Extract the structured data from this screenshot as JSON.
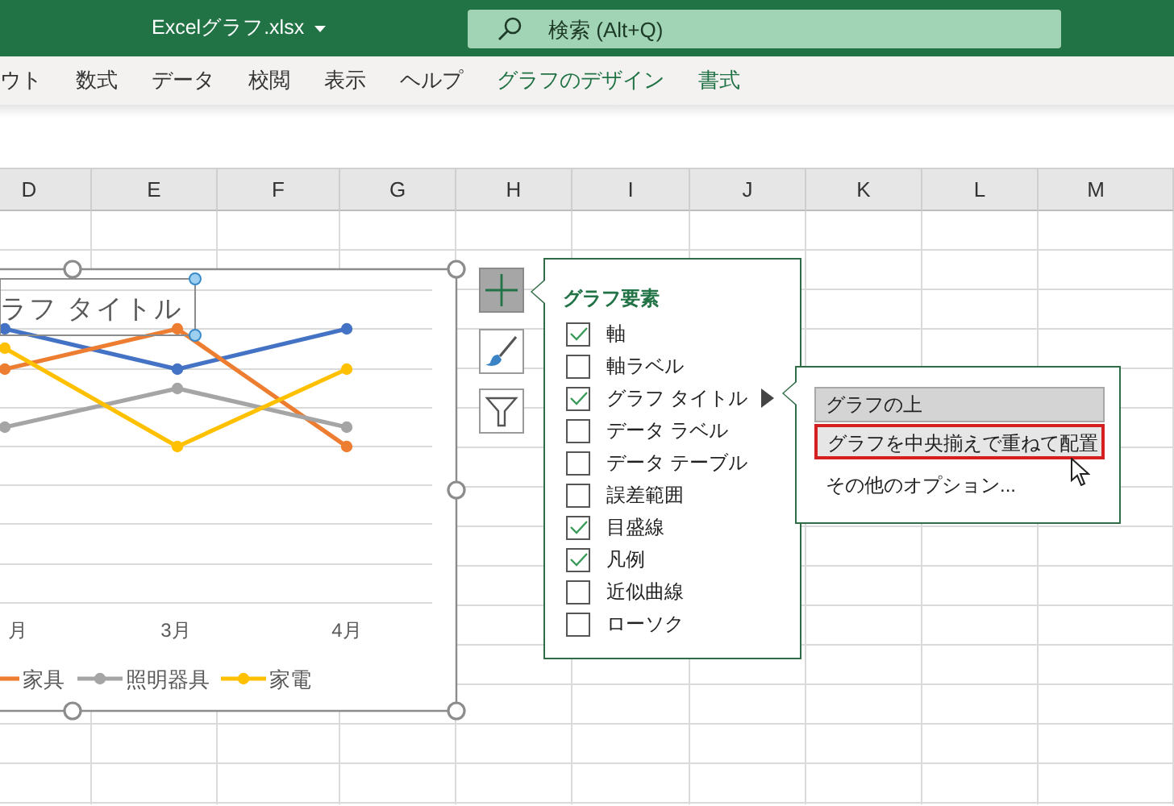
{
  "title_bar": {
    "filename": "Excelグラフ.xlsx",
    "search": {
      "placeholder": "検索 (Alt+Q)"
    }
  },
  "ribbon_tabs": [
    {
      "label": "ウト",
      "contextual": false
    },
    {
      "label": "数式",
      "contextual": false
    },
    {
      "label": "データ",
      "contextual": false
    },
    {
      "label": "校閲",
      "contextual": false
    },
    {
      "label": "表示",
      "contextual": false
    },
    {
      "label": "ヘルプ",
      "contextual": false
    },
    {
      "label": "グラフのデザイン",
      "contextual": true
    },
    {
      "label": "書式",
      "contextual": true
    }
  ],
  "column_headers": [
    "D",
    "E",
    "F",
    "G",
    "H",
    "I",
    "J",
    "K",
    "L",
    "M"
  ],
  "chart": {
    "title": "ラフ タイトル",
    "x_labels": [
      "月",
      "3月",
      "4月"
    ],
    "series": [
      {
        "color": "#4472c4"
      },
      {
        "color": "#ed7d31",
        "legend": "家具"
      },
      {
        "color": "#a5a5a5",
        "legend": "照明器具"
      },
      {
        "color": "#ffc000",
        "legend": "家電"
      }
    ]
  },
  "chart_buttons": [
    {
      "kind": "elements",
      "selected": true
    },
    {
      "kind": "styles",
      "selected": false
    },
    {
      "kind": "filter",
      "selected": false
    }
  ],
  "elements_panel": {
    "title": "グラフ要素",
    "items": [
      {
        "label": "軸",
        "checked": true,
        "expanded": false
      },
      {
        "label": "軸ラベル",
        "checked": false,
        "expanded": false
      },
      {
        "label": "グラフ タイトル",
        "checked": true,
        "expanded": true
      },
      {
        "label": "データ ラベル",
        "checked": false,
        "expanded": false
      },
      {
        "label": "データ テーブル",
        "checked": false,
        "expanded": false
      },
      {
        "label": "誤差範囲",
        "checked": false,
        "expanded": false
      },
      {
        "label": "目盛線",
        "checked": true,
        "expanded": false
      },
      {
        "label": "凡例",
        "checked": true,
        "expanded": false
      },
      {
        "label": "近似曲線",
        "checked": false,
        "expanded": false
      },
      {
        "label": "ローソク",
        "checked": false,
        "expanded": false
      }
    ]
  },
  "submenu": {
    "items": [
      {
        "label": "グラフの上",
        "selected": true,
        "hovered": false,
        "marked": false
      },
      {
        "label": "グラフを中央揃えで重ねて配置",
        "selected": false,
        "hovered": true,
        "marked": true
      },
      {
        "label": "その他のオプション...",
        "selected": false,
        "hovered": false,
        "marked": false
      }
    ]
  }
}
